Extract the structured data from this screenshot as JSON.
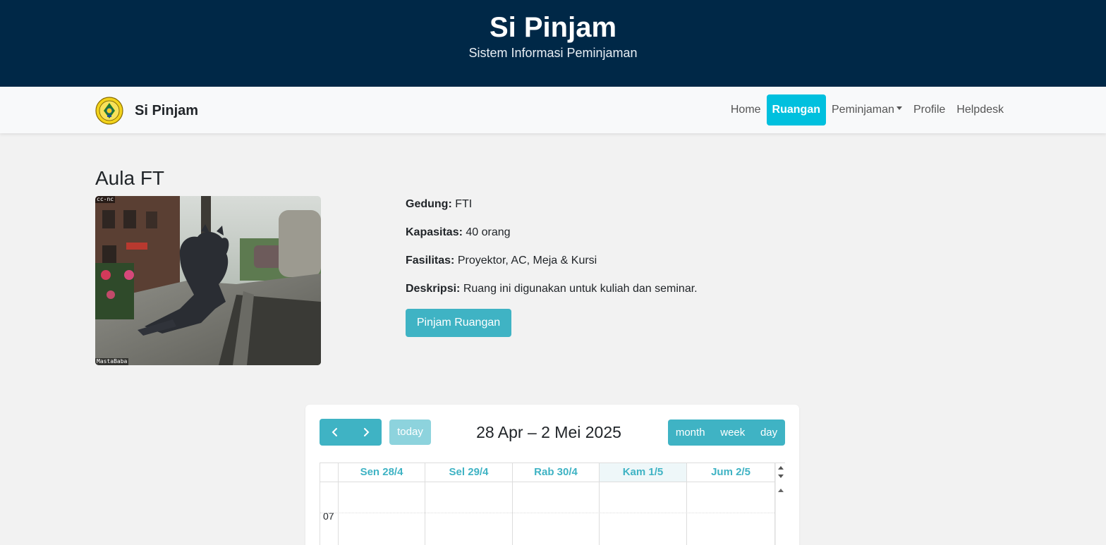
{
  "banner": {
    "title": "Si Pinjam",
    "subtitle": "Sistem Informasi Peminjaman"
  },
  "navbar": {
    "brand": "Si Pinjam",
    "links": [
      {
        "label": "Home",
        "active": false
      },
      {
        "label": "Ruangan",
        "active": true
      },
      {
        "label": "Peminjaman",
        "active": false,
        "dropdown": true
      },
      {
        "label": "Profile",
        "active": false
      },
      {
        "label": "Helpdesk",
        "active": false
      }
    ],
    "active_color": "#00c0de"
  },
  "room": {
    "name": "Aula FT",
    "photo_tags": {
      "top_left": "cc-nc",
      "bottom_left": "MastaBaba"
    },
    "gedung_label": "Gedung:",
    "gedung": "FTI",
    "kapasitas_label": "Kapasitas:",
    "kapasitas": "40 orang",
    "fasilitas_label": "Fasilitas:",
    "fasilitas": "Proyektor, AC, Meja & Kursi",
    "deskripsi_label": "Deskripsi:",
    "deskripsi": "Ruang ini digunakan untuk kuliah dan seminar.",
    "button_label": "Pinjam Ruangan"
  },
  "calendar": {
    "today_label": "today",
    "title": "28 Apr – 2 Mei 2025",
    "views": [
      "month",
      "week",
      "day"
    ],
    "days": [
      {
        "label": "Sen 28/4",
        "today": false
      },
      {
        "label": "Sel 29/4",
        "today": false
      },
      {
        "label": "Rab 30/4",
        "today": false
      },
      {
        "label": "Kam 1/5",
        "today": true
      },
      {
        "label": "Jum 2/5",
        "today": false
      }
    ],
    "first_hour": "07",
    "accent_color": "#3fb3c4"
  }
}
